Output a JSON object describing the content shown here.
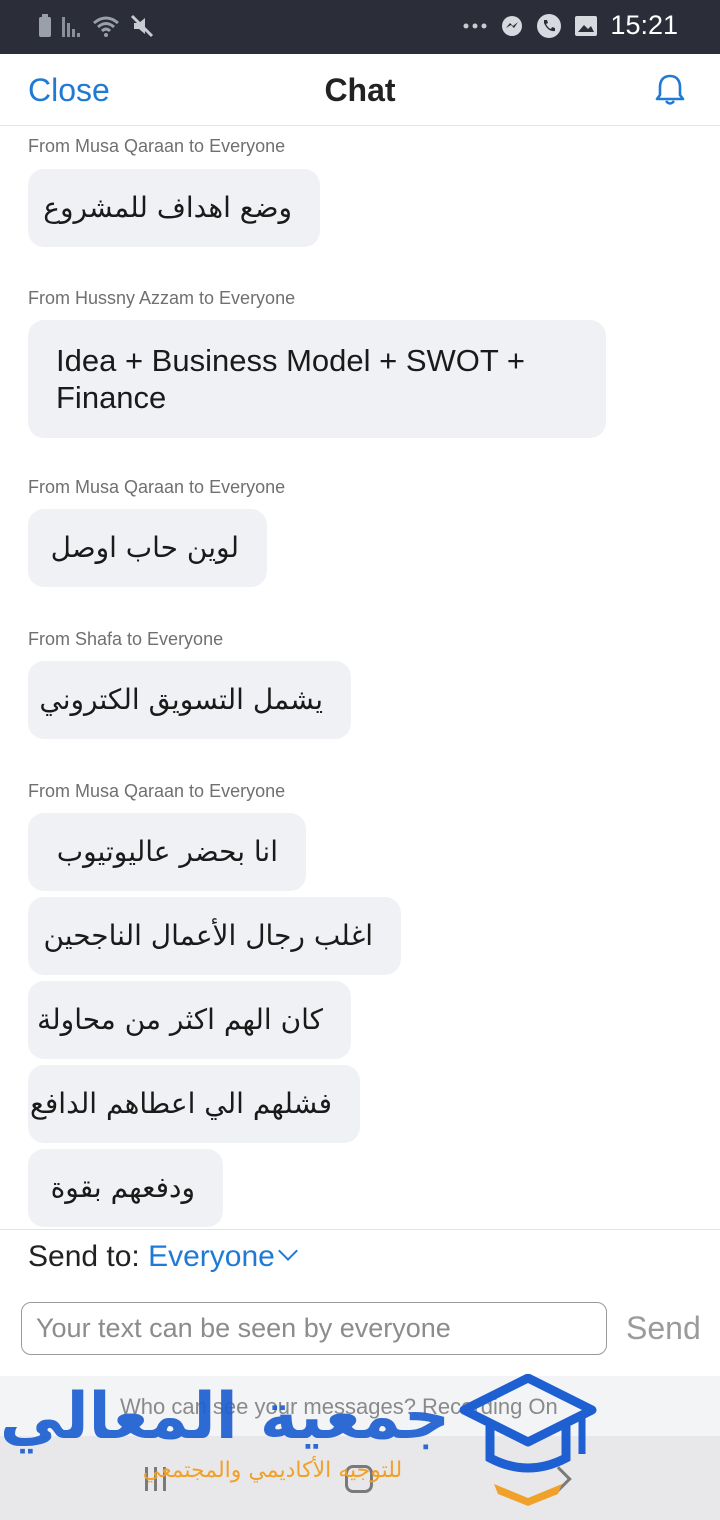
{
  "status_bar": {
    "time": "15:21",
    "icons_left": [
      "battery-icon",
      "signal-icon",
      "wifi-icon",
      "mute-icon"
    ],
    "icons_right": [
      "more-dots-icon",
      "messenger-icon",
      "phone-icon",
      "gallery-icon"
    ]
  },
  "header": {
    "close_label": "Close",
    "title": "Chat",
    "bell_icon": "bell-icon",
    "accent_color": "#1f7ad6"
  },
  "messages": [
    {
      "sender": "From Musa Qaraan to Everyone",
      "bubbles": [
        "وضع اهداف للمشروع"
      ]
    },
    {
      "sender": "From Hussny Azzam to Everyone",
      "bubbles": [
        "Idea + Business Model + SWOT + Finance"
      ]
    },
    {
      "sender": "From Musa Qaraan to Everyone",
      "bubbles": [
        "لوين حاب اوصل"
      ]
    },
    {
      "sender": "From Shafa to Everyone",
      "bubbles": [
        "يشمل التسويق الكتروني"
      ]
    },
    {
      "sender": "From Musa Qaraan to Everyone",
      "bubbles": [
        "انا بحضر عاليوتيوب",
        "اغلب رجال الأعمال الناجحين",
        "كان الهم اكثر من محاولة",
        "فشلهم الي اعطاهم الدافع",
        "ودفعهم بقوة"
      ]
    }
  ],
  "composer": {
    "send_to_label": "Send to:",
    "send_to_value": "Everyone",
    "placeholder": "Your text can be seen by everyone",
    "send_label": "Send"
  },
  "info": {
    "text": "Who can see your messages? Recording On"
  },
  "watermark": {
    "title": "جمعية المعالي",
    "subtitle": "للتوجيه الأكاديمي والمجتمعي",
    "blue": "#1e5fd1",
    "orange": "#f0a12a"
  }
}
